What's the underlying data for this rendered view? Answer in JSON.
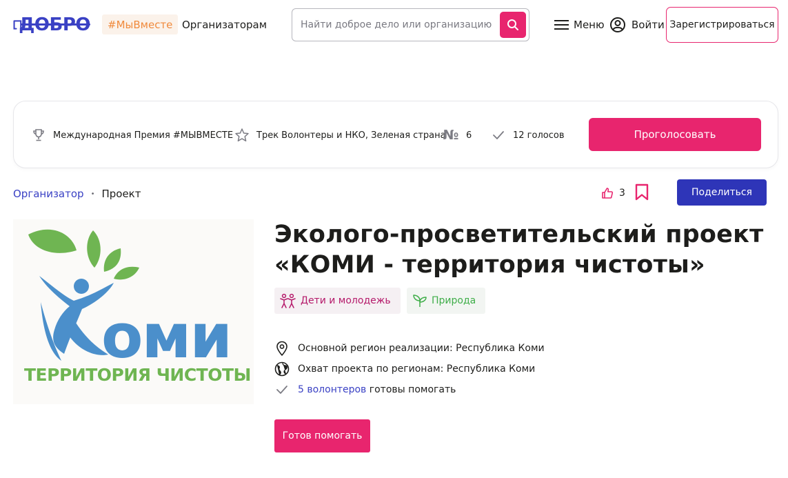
{
  "header": {
    "logo_text": "ДОБРО",
    "tag_label": "#МыВместе",
    "organizers_label": "Организаторам",
    "search_placeholder": "Найти доброе дело или организацию",
    "menu_label": "Меню",
    "login_label": "Войти",
    "register_label": "Зарегистрироваться"
  },
  "vote": {
    "award_label": "Международная Премия #МЫВМЕСТЕ",
    "track_label": "Трек Волонтеры и НКО, Зеленая страна",
    "number_sign": "№",
    "number_value": "6",
    "votes_label": "12 голосов",
    "vote_button": "Проголосовать"
  },
  "breadcrumb": {
    "organizer": "Организатор",
    "separator": "•",
    "project": "Проект"
  },
  "actions": {
    "likes_count": "3",
    "share_label": "Поделиться"
  },
  "project": {
    "title": "Эколого-просветительский проект «КОМИ - территория чистоты»",
    "logo_word": "оми",
    "logo_subtitle": "ТЕРРИТОРИЯ ЧИСТОТЫ",
    "categories": [
      {
        "label": "Дети и молодежь",
        "icon": "children-icon",
        "color": "#b5196a"
      },
      {
        "label": "Природа",
        "icon": "sprout-icon",
        "color": "#3fae49"
      }
    ],
    "main_region": "Основной регион реализации: Республика Коми",
    "coverage": "Охват проекта по регионам: Республика Коми",
    "volunteers_link": "5 волонтеров",
    "volunteers_suffix": " готовы помогать",
    "help_button": "Готов помогать"
  },
  "colors": {
    "accent": "#e8256e",
    "brand_blue": "#3a41c4",
    "share_blue": "#2e35b8"
  }
}
